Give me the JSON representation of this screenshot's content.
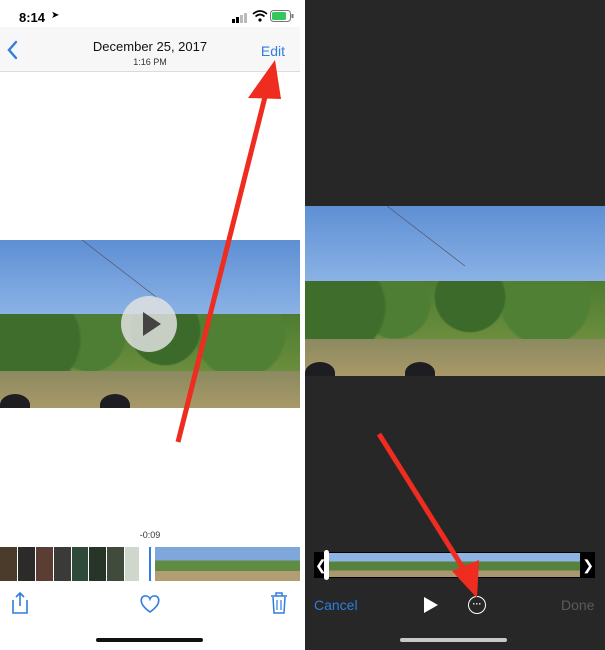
{
  "left": {
    "status_time": "8:14",
    "nav": {
      "back_icon": "chevron-left-icon",
      "date": "December 25, 2017",
      "time": "1:16 PM",
      "edit_label": "Edit"
    },
    "video_time": "-0:09",
    "toolbar": {
      "share_icon": "share-icon",
      "favorite_icon": "heart-icon",
      "delete_icon": "trash-icon"
    }
  },
  "right": {
    "cancel_label": "Cancel",
    "done_label": "Done",
    "play_icon": "play-icon",
    "more_icon": "ellipsis-circle-icon"
  },
  "colors": {
    "accent": "#2f7dde",
    "arrow": "#ee2c1f",
    "dark_bg": "#272727"
  }
}
